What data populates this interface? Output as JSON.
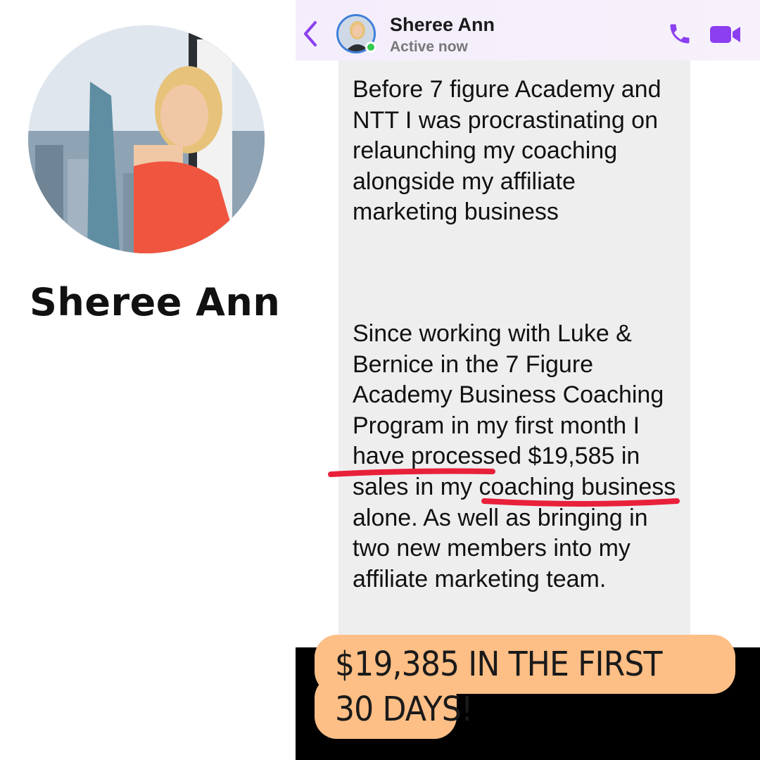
{
  "profile": {
    "name": "Sheree Ann"
  },
  "chat_header": {
    "contact_name": "Sheree Ann",
    "status": "Active now",
    "back_icon": "chevron-left-icon",
    "call_icon": "phone-icon",
    "video_icon": "video-camera-icon"
  },
  "message": {
    "paragraph_1": "Before 7 figure Academy and NTT I was procrastinating on relaunching my coaching alongside my affiliate marketing business",
    "paragraph_2": "Since working with Luke & Bernice in the 7 Figure Academy Business Coaching Program in my first month I have processed $19,585 in sales in my coaching business alone. As well as bringing in two new members into my affiliate marketing team."
  },
  "caption": {
    "text": "$19,385 IN THE FIRST 30 DAYS!"
  },
  "colors": {
    "accent": "#8b3ff0",
    "bubble": "#eeeeef",
    "caption_bg": "#fdbf86",
    "underline": "#e8203a",
    "online": "#31c94e"
  }
}
